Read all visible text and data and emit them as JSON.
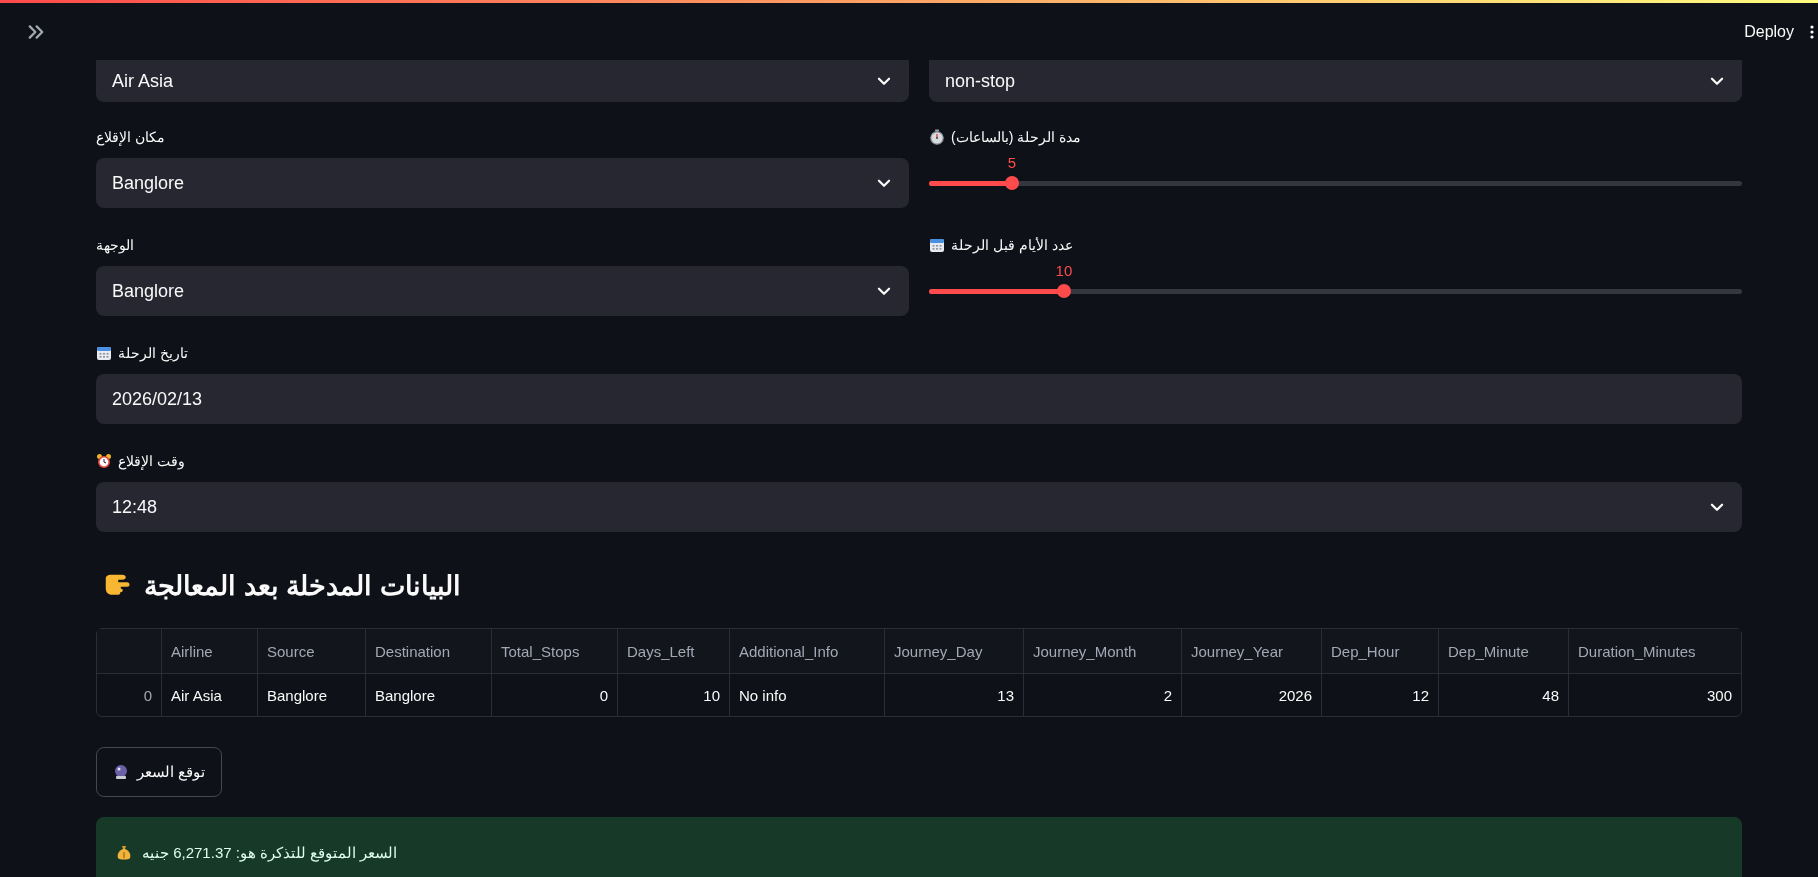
{
  "header": {
    "deploy": "Deploy"
  },
  "top_row": [
    {
      "kind": "select",
      "value": "Air Asia"
    },
    {
      "kind": "select",
      "value": "non-stop"
    }
  ],
  "left_column": [
    {
      "kind": "select",
      "label": "مكان الإقلاع",
      "value": "Banglore"
    },
    {
      "kind": "select",
      "label": "الوجهة",
      "value": "Banglore"
    }
  ],
  "right_column": [
    {
      "kind": "slider",
      "label": "مدة الرحلة (بالساعات)",
      "value": "5",
      "level": 0.102
    },
    {
      "kind": "slider",
      "label": "عدد الأيام قبل الرحلة",
      "value": "10",
      "level": 0.166
    }
  ],
  "full": [
    {
      "kind": "date",
      "label": "تاريخ الرحلة",
      "value": "2026/02/13"
    },
    {
      "kind": "select",
      "label": "وقت الإقلاع",
      "value": "12:48"
    }
  ],
  "heading": "البيانات المدخلة بعد المعالجة",
  "table": {
    "columns": [
      {
        "label": "Airline",
        "kind": "text"
      },
      {
        "label": "Source",
        "kind": "text"
      },
      {
        "label": "Destination",
        "kind": "text"
      },
      {
        "label": "Total_Stops",
        "kind": "number"
      },
      {
        "label": "Days_Left",
        "kind": "number"
      },
      {
        "label": "Additional_Info",
        "kind": "text"
      },
      {
        "label": "Journey_Day",
        "kind": "number"
      },
      {
        "label": "Journey_Month",
        "kind": "number"
      },
      {
        "label": "Journey_Year",
        "kind": "number"
      },
      {
        "label": "Dep_Hour",
        "kind": "number"
      },
      {
        "label": "Dep_Minute",
        "kind": "number"
      },
      {
        "label": "Duration_Minutes",
        "kind": "number"
      }
    ],
    "rows": [
      {
        "index": "0",
        "cells": [
          "Air Asia",
          "Banglore",
          "Banglore",
          "0",
          "10",
          "No info",
          "13",
          "2",
          "2026",
          "12",
          "48",
          "300"
        ]
      }
    ]
  },
  "button": "توقع السعر",
  "result": "السعر المتوقع للتذكرة هو: 6,271.37 جنيه"
}
